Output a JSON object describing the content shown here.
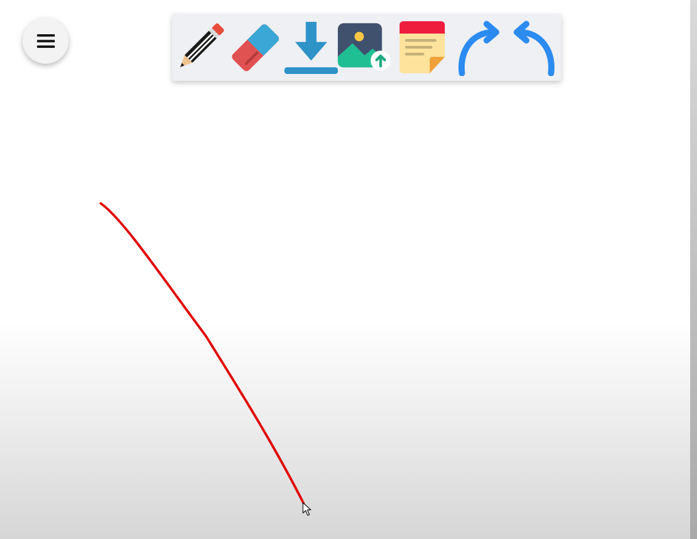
{
  "app": {
    "background": "#ffffff"
  },
  "menu": {
    "icon": "hamburger-menu-icon"
  },
  "toolbar": {
    "tools": [
      {
        "id": "pencil",
        "icon": "pencil-icon"
      },
      {
        "id": "eraser",
        "icon": "eraser-icon"
      },
      {
        "id": "download",
        "icon": "download-icon"
      },
      {
        "id": "upload-image",
        "icon": "image-upload-icon"
      },
      {
        "id": "sticky-note",
        "icon": "sticky-note-icon"
      },
      {
        "id": "redo",
        "icon": "redo-arrow-icon"
      },
      {
        "id": "undo",
        "icon": "undo-arrow-icon"
      }
    ]
  },
  "canvas": {
    "stroke_color": "#e10000",
    "cursor": "arrow-pointer-icon"
  }
}
